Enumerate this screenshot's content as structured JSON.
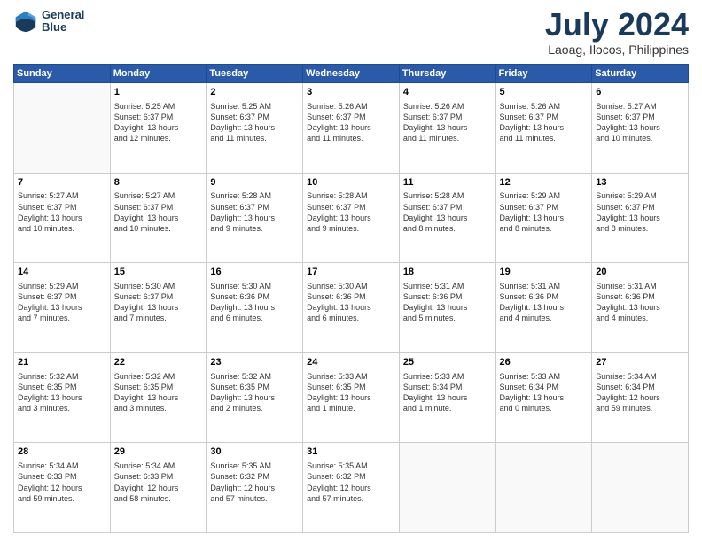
{
  "header": {
    "logo_line1": "General",
    "logo_line2": "Blue",
    "title": "July 2024",
    "subtitle": "Laoag, Ilocos, Philippines"
  },
  "columns": [
    "Sunday",
    "Monday",
    "Tuesday",
    "Wednesday",
    "Thursday",
    "Friday",
    "Saturday"
  ],
  "weeks": [
    [
      {
        "day": "",
        "info": ""
      },
      {
        "day": "1",
        "info": "Sunrise: 5:25 AM\nSunset: 6:37 PM\nDaylight: 13 hours\nand 12 minutes."
      },
      {
        "day": "2",
        "info": "Sunrise: 5:25 AM\nSunset: 6:37 PM\nDaylight: 13 hours\nand 11 minutes."
      },
      {
        "day": "3",
        "info": "Sunrise: 5:26 AM\nSunset: 6:37 PM\nDaylight: 13 hours\nand 11 minutes."
      },
      {
        "day": "4",
        "info": "Sunrise: 5:26 AM\nSunset: 6:37 PM\nDaylight: 13 hours\nand 11 minutes."
      },
      {
        "day": "5",
        "info": "Sunrise: 5:26 AM\nSunset: 6:37 PM\nDaylight: 13 hours\nand 11 minutes."
      },
      {
        "day": "6",
        "info": "Sunrise: 5:27 AM\nSunset: 6:37 PM\nDaylight: 13 hours\nand 10 minutes."
      }
    ],
    [
      {
        "day": "7",
        "info": "Sunrise: 5:27 AM\nSunset: 6:37 PM\nDaylight: 13 hours\nand 10 minutes."
      },
      {
        "day": "8",
        "info": "Sunrise: 5:27 AM\nSunset: 6:37 PM\nDaylight: 13 hours\nand 10 minutes."
      },
      {
        "day": "9",
        "info": "Sunrise: 5:28 AM\nSunset: 6:37 PM\nDaylight: 13 hours\nand 9 minutes."
      },
      {
        "day": "10",
        "info": "Sunrise: 5:28 AM\nSunset: 6:37 PM\nDaylight: 13 hours\nand 9 minutes."
      },
      {
        "day": "11",
        "info": "Sunrise: 5:28 AM\nSunset: 6:37 PM\nDaylight: 13 hours\nand 8 minutes."
      },
      {
        "day": "12",
        "info": "Sunrise: 5:29 AM\nSunset: 6:37 PM\nDaylight: 13 hours\nand 8 minutes."
      },
      {
        "day": "13",
        "info": "Sunrise: 5:29 AM\nSunset: 6:37 PM\nDaylight: 13 hours\nand 8 minutes."
      }
    ],
    [
      {
        "day": "14",
        "info": "Sunrise: 5:29 AM\nSunset: 6:37 PM\nDaylight: 13 hours\nand 7 minutes."
      },
      {
        "day": "15",
        "info": "Sunrise: 5:30 AM\nSunset: 6:37 PM\nDaylight: 13 hours\nand 7 minutes."
      },
      {
        "day": "16",
        "info": "Sunrise: 5:30 AM\nSunset: 6:36 PM\nDaylight: 13 hours\nand 6 minutes."
      },
      {
        "day": "17",
        "info": "Sunrise: 5:30 AM\nSunset: 6:36 PM\nDaylight: 13 hours\nand 6 minutes."
      },
      {
        "day": "18",
        "info": "Sunrise: 5:31 AM\nSunset: 6:36 PM\nDaylight: 13 hours\nand 5 minutes."
      },
      {
        "day": "19",
        "info": "Sunrise: 5:31 AM\nSunset: 6:36 PM\nDaylight: 13 hours\nand 4 minutes."
      },
      {
        "day": "20",
        "info": "Sunrise: 5:31 AM\nSunset: 6:36 PM\nDaylight: 13 hours\nand 4 minutes."
      }
    ],
    [
      {
        "day": "21",
        "info": "Sunrise: 5:32 AM\nSunset: 6:35 PM\nDaylight: 13 hours\nand 3 minutes."
      },
      {
        "day": "22",
        "info": "Sunrise: 5:32 AM\nSunset: 6:35 PM\nDaylight: 13 hours\nand 3 minutes."
      },
      {
        "day": "23",
        "info": "Sunrise: 5:32 AM\nSunset: 6:35 PM\nDaylight: 13 hours\nand 2 minutes."
      },
      {
        "day": "24",
        "info": "Sunrise: 5:33 AM\nSunset: 6:35 PM\nDaylight: 13 hours\nand 1 minute."
      },
      {
        "day": "25",
        "info": "Sunrise: 5:33 AM\nSunset: 6:34 PM\nDaylight: 13 hours\nand 1 minute."
      },
      {
        "day": "26",
        "info": "Sunrise: 5:33 AM\nSunset: 6:34 PM\nDaylight: 13 hours\nand 0 minutes."
      },
      {
        "day": "27",
        "info": "Sunrise: 5:34 AM\nSunset: 6:34 PM\nDaylight: 12 hours\nand 59 minutes."
      }
    ],
    [
      {
        "day": "28",
        "info": "Sunrise: 5:34 AM\nSunset: 6:33 PM\nDaylight: 12 hours\nand 59 minutes."
      },
      {
        "day": "29",
        "info": "Sunrise: 5:34 AM\nSunset: 6:33 PM\nDaylight: 12 hours\nand 58 minutes."
      },
      {
        "day": "30",
        "info": "Sunrise: 5:35 AM\nSunset: 6:32 PM\nDaylight: 12 hours\nand 57 minutes."
      },
      {
        "day": "31",
        "info": "Sunrise: 5:35 AM\nSunset: 6:32 PM\nDaylight: 12 hours\nand 57 minutes."
      },
      {
        "day": "",
        "info": ""
      },
      {
        "day": "",
        "info": ""
      },
      {
        "day": "",
        "info": ""
      }
    ]
  ]
}
